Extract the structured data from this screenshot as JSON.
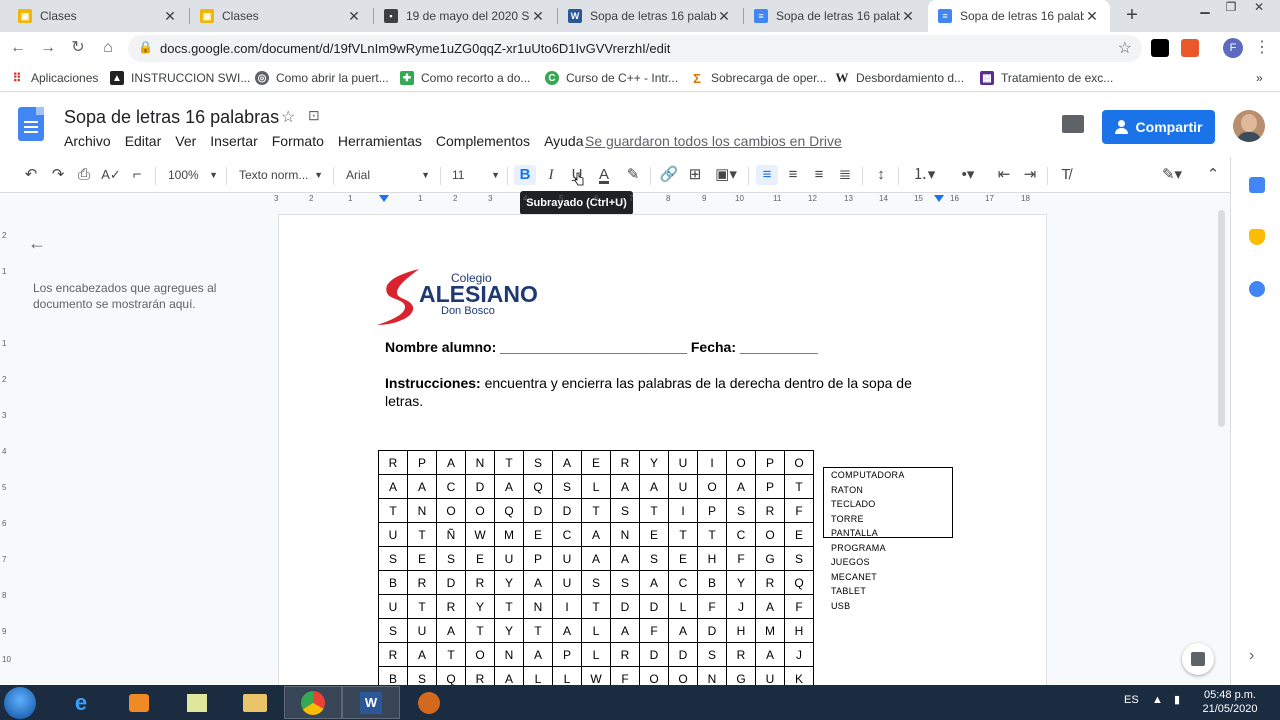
{
  "browser": {
    "tabs": [
      {
        "title": "Clases",
        "icon": "classroom-icon",
        "active": false
      },
      {
        "title": "Clases",
        "icon": "classroom-icon",
        "active": false
      },
      {
        "title": "19 de mayo del 2020 So",
        "icon": "slides-icon",
        "active": false
      },
      {
        "title": "Sopa de letras 16 palabra",
        "icon": "word-icon",
        "active": false
      },
      {
        "title": "Sopa de letras 16 palabra",
        "icon": "docs-icon",
        "active": false
      },
      {
        "title": "Sopa de letras 16 palabra",
        "icon": "docs-icon",
        "active": true
      }
    ],
    "url": "docs.google.com/document/d/19fVLnIm9wRyme1uZG0qqZ-xr1uUto6D1IvGVVrerzhI/edit",
    "profile_letter": "F",
    "bookmarks": [
      {
        "label": "Aplicaciones"
      },
      {
        "label": "INSTRUCCION SWI..."
      },
      {
        "label": "Como abrir la puert..."
      },
      {
        "label": "Como recorto a do..."
      },
      {
        "label": "Curso de C++ - Intr..."
      },
      {
        "label": "Sobrecarga de oper..."
      },
      {
        "label": "Desbordamiento d..."
      },
      {
        "label": "Tratamiento de exc..."
      }
    ],
    "more_bookmarks": "»"
  },
  "docs": {
    "title": "Sopa de letras 16 palabras",
    "menu": [
      "Archivo",
      "Editar",
      "Ver",
      "Insertar",
      "Formato",
      "Herramientas",
      "Complementos",
      "Ayuda"
    ],
    "save_status": "Se guardaron todos los cambios en Drive",
    "share_label": "Compartir",
    "toolbar": {
      "zoom": "100%",
      "style": "Texto norm...",
      "font": "Arial",
      "size": "11",
      "bold": "B",
      "italic": "I",
      "underline": "U",
      "text_color": "A",
      "tooltip": "Subrayado (Ctrl+U)"
    },
    "ruler_numbers": [
      "3",
      "2",
      "1",
      "1",
      "2",
      "3",
      "4",
      "5",
      "6",
      "7",
      "8",
      "9",
      "10",
      "11",
      "12",
      "13",
      "14",
      "15",
      "16",
      "17",
      "18"
    ],
    "outline_hint": "Los encabezados que agregues al documento se mostrarán aquí."
  },
  "document": {
    "logo": {
      "line1": "Colegio",
      "line2": "ALESIANO",
      "line3": "Don Bosco"
    },
    "name_line": "Nombre alumno: ________________________ Fecha: __________",
    "instructions_label": "Instrucciones:",
    "instructions_text": " encuentra y encierra las palabras de la derecha dentro de la sopa de letras.",
    "grid": [
      [
        "R",
        "P",
        "A",
        "N",
        "T",
        "S",
        "A",
        "E",
        "R",
        "Y",
        "U",
        "I",
        "O",
        "P",
        "O"
      ],
      [
        "A",
        "A",
        "C",
        "D",
        "A",
        "Q",
        "S",
        "L",
        "A",
        "A",
        "U",
        "O",
        "A",
        "P",
        "T"
      ],
      [
        "T",
        "N",
        "O",
        "O",
        "Q",
        "D",
        "D",
        "T",
        "S",
        "T",
        "I",
        "P",
        "S",
        "R",
        "F"
      ],
      [
        "U",
        "T",
        "Ñ",
        "W",
        "M",
        "E",
        "C",
        "A",
        "N",
        "E",
        "T",
        "T",
        "C",
        "O",
        "E"
      ],
      [
        "S",
        "E",
        "S",
        "E",
        "U",
        "P",
        "U",
        "A",
        "A",
        "S",
        "E",
        "H",
        "F",
        "G",
        "S"
      ],
      [
        "B",
        "R",
        "D",
        "R",
        "Y",
        "A",
        "U",
        "S",
        "S",
        "A",
        "C",
        "B",
        "Y",
        "R",
        "Q"
      ],
      [
        "U",
        "T",
        "R",
        "Y",
        "T",
        "N",
        "I",
        "T",
        "D",
        "D",
        "L",
        "F",
        "J",
        "A",
        "F"
      ],
      [
        "S",
        "U",
        "A",
        "T",
        "Y",
        "T",
        "A",
        "L",
        "A",
        "F",
        "A",
        "D",
        "H",
        "M",
        "H"
      ],
      [
        "R",
        "A",
        "T",
        "O",
        "N",
        "A",
        "P",
        "L",
        "R",
        "D",
        "D",
        "S",
        "R",
        "A",
        "J"
      ],
      [
        "B",
        "S",
        "Q",
        "R",
        "A",
        "L",
        "L",
        "W",
        "F",
        "O",
        "O",
        "N",
        "G",
        "U",
        "K"
      ]
    ],
    "words": [
      "COMPUTADORA",
      "RATON",
      "TECLADO",
      "TORRE",
      "PANTALLA",
      "PROGRAMA",
      "JUEGOS",
      "MECANET",
      "TABLET",
      "USB"
    ]
  },
  "taskbar": {
    "language": "ES",
    "time": "05:48 p.m.",
    "date": "21/05/2020"
  }
}
